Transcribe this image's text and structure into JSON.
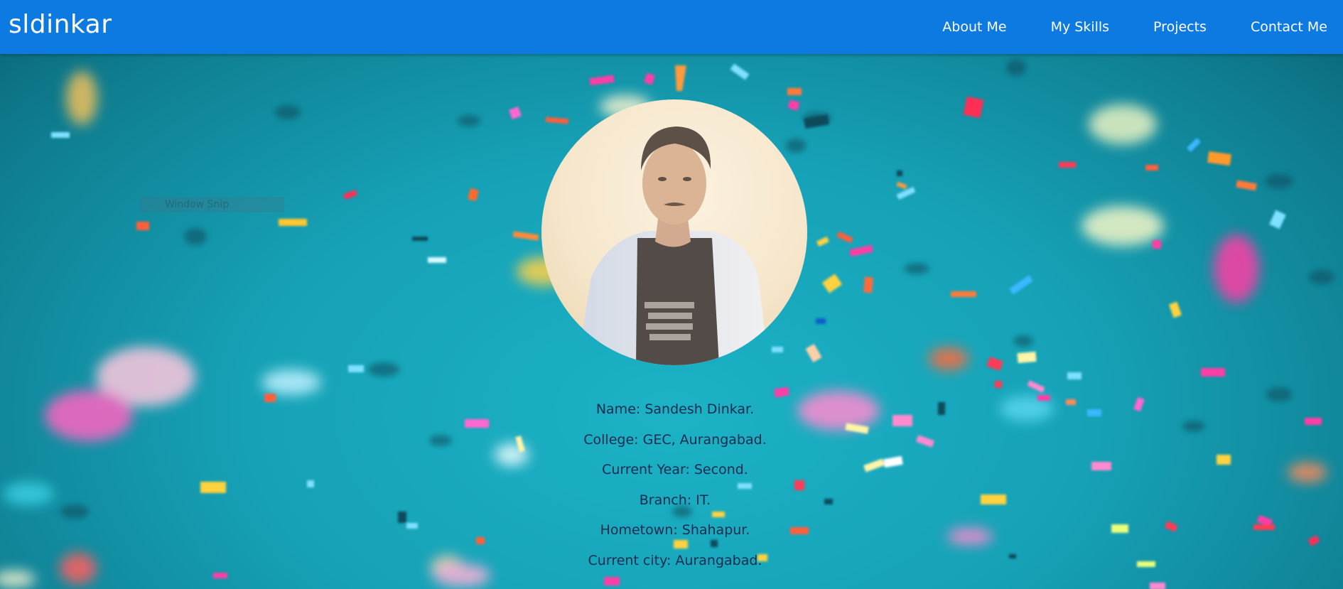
{
  "navbar": {
    "brand": "sldinkar",
    "links": [
      "About Me",
      "My Skills",
      "Projects",
      "Contact Me"
    ],
    "background_color": "#0d7ae2"
  },
  "overlay": {
    "window_snip_label": "Window Snip"
  },
  "avatar": {
    "icon": "profile-photo"
  },
  "profile": {
    "lines": [
      "Name: Sandesh Dinkar.",
      "College: GEC, Aurangabad.",
      "Current Year: Second.",
      "Branch: IT.",
      "Hometown: Shahapur.",
      "Current city: Aurangabad."
    ],
    "text_color": "#1b2b4f"
  },
  "background": {
    "base_color": "#16a1b6",
    "confetti_colors": [
      "#ff3ea5",
      "#ffd23f",
      "#ff5e3a",
      "#7fe0ff",
      "#ffffff",
      "#ff2d55",
      "#a8f0ff"
    ]
  }
}
